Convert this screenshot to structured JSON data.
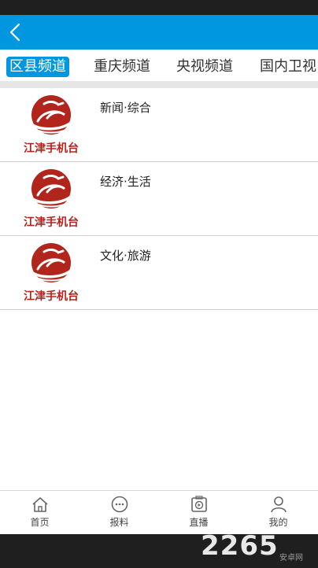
{
  "header": {
    "back_icon": "chevron-left-icon"
  },
  "tabs": [
    {
      "label": "区县频道",
      "active": true
    },
    {
      "label": "重庆频道",
      "active": false
    },
    {
      "label": "央视频道",
      "active": false
    },
    {
      "label": "国内卫视",
      "active": false
    }
  ],
  "channels": [
    {
      "logo_text": "江津手机台",
      "title": "新闻·综合"
    },
    {
      "logo_text": "江津手机台",
      "title": "经济·生活"
    },
    {
      "logo_text": "江津手机台",
      "title": "文化·旅游"
    }
  ],
  "bottom_nav": [
    {
      "label": "首页",
      "icon": "home-icon"
    },
    {
      "label": "报料",
      "icon": "chat-icon"
    },
    {
      "label": "直播",
      "icon": "live-icon"
    },
    {
      "label": "我的",
      "icon": "user-icon"
    }
  ],
  "watermark": {
    "main": "2265",
    "sub": "安卓网"
  },
  "colors": {
    "primary": "#0096e0",
    "logo_red": "#b2251c"
  }
}
